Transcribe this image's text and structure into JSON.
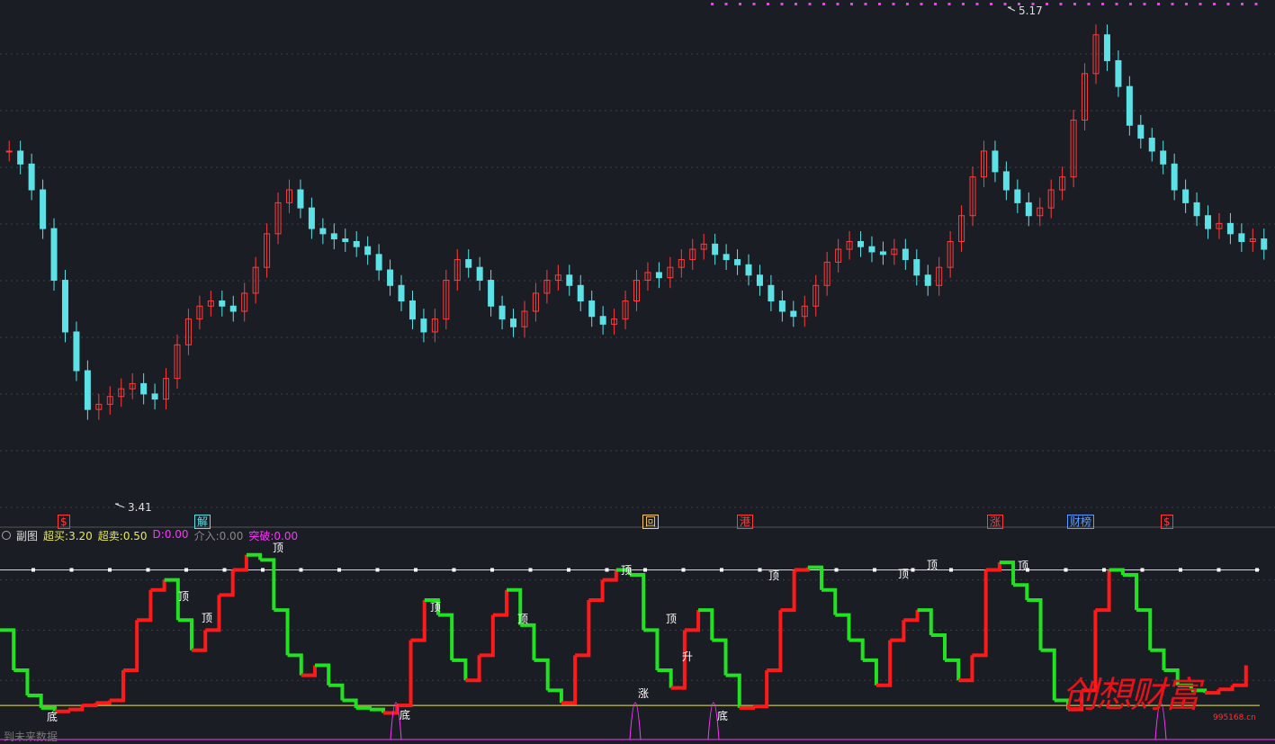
{
  "colors": {
    "background": "#1b1d24",
    "up": "#ff3b3b",
    "down": "#5ce1e6",
    "osc_up": "#ff1a1a",
    "osc_down": "#22e022",
    "threshold": "#e8e85a",
    "magenta": "#ff33ff",
    "grid": "#3a3f4a"
  },
  "main_chart": {
    "high_label": "5.17",
    "low_label": "3.41",
    "event_markers": [
      {
        "id": "marker-s1",
        "text": "$",
        "color": "#ff3b3b",
        "x_index": 0
      },
      {
        "id": "marker-jie",
        "text": "解",
        "color": "#5ce1e6",
        "x_index": 1
      },
      {
        "id": "marker-hui",
        "text": "回",
        "color": "#ffcc55",
        "x_index": 2
      },
      {
        "id": "marker-gang",
        "text": "港",
        "color": "#ff3b3b",
        "x_index": 3
      },
      {
        "id": "marker-zhang",
        "text": "涨",
        "color": "#ff3b3b",
        "x_index": 4
      },
      {
        "id": "marker-caibang",
        "text": "财榜",
        "color": "#5c9bff",
        "x_index": 5
      },
      {
        "id": "marker-s2",
        "text": "$",
        "color": "#ff3b3b",
        "x_index": 6
      }
    ]
  },
  "sub_chart": {
    "title": "副图",
    "legend": [
      {
        "label": "超买:",
        "value": "3.20",
        "color": "#e8e85a"
      },
      {
        "label": "超卖:",
        "value": "0.50",
        "color": "#e8e85a"
      },
      {
        "label": "D:",
        "value": "0.00",
        "color": "#ff33ff"
      },
      {
        "label": "介入:",
        "value": "0.00",
        "color": "#888888"
      },
      {
        "label": "突破:",
        "value": "0.00",
        "color": "#ff33ff"
      }
    ],
    "footer_text": "到未来数据",
    "signal_labels": [
      {
        "text": "底",
        "x": 52,
        "y": 801
      },
      {
        "text": "顶",
        "x": 198,
        "y": 667
      },
      {
        "text": "顶",
        "x": 224,
        "y": 691
      },
      {
        "text": "顶",
        "x": 303,
        "y": 613
      },
      {
        "text": "底",
        "x": 444,
        "y": 799
      },
      {
        "text": "顶",
        "x": 478,
        "y": 679
      },
      {
        "text": "顶",
        "x": 575,
        "y": 692
      },
      {
        "text": "顶",
        "x": 690,
        "y": 638
      },
      {
        "text": "涨",
        "x": 709,
        "y": 775
      },
      {
        "text": "顶",
        "x": 740,
        "y": 692
      },
      {
        "text": "升",
        "x": 758,
        "y": 734
      },
      {
        "text": "底",
        "x": 797,
        "y": 800
      },
      {
        "text": "顶",
        "x": 854,
        "y": 644
      },
      {
        "text": "顶",
        "x": 998,
        "y": 642
      },
      {
        "text": "顶",
        "x": 1030,
        "y": 632
      },
      {
        "text": "顶",
        "x": 1131,
        "y": 633
      }
    ]
  },
  "watermark": {
    "text": "创想财富",
    "url": "995168.cn"
  },
  "chart_data": {
    "type": "candlestick",
    "title": "",
    "price_high": 5.17,
    "price_low": 3.41,
    "ylim": [
      3.3,
      5.25
    ],
    "price_series": [
      4.7,
      4.65,
      4.55,
      4.4,
      4.2,
      4.0,
      3.85,
      3.7,
      3.72,
      3.75,
      3.78,
      3.8,
      3.76,
      3.74,
      3.82,
      3.95,
      4.05,
      4.1,
      4.12,
      4.1,
      4.08,
      4.15,
      4.25,
      4.38,
      4.5,
      4.55,
      4.48,
      4.4,
      4.38,
      4.36,
      4.35,
      4.33,
      4.3,
      4.24,
      4.18,
      4.12,
      4.05,
      4.0,
      4.05,
      4.2,
      4.28,
      4.25,
      4.2,
      4.1,
      4.05,
      4.02,
      4.08,
      4.15,
      4.2,
      4.22,
      4.18,
      4.12,
      4.06,
      4.03,
      4.05,
      4.12,
      4.2,
      4.23,
      4.21,
      4.25,
      4.28,
      4.32,
      4.34,
      4.3,
      4.28,
      4.26,
      4.22,
      4.18,
      4.12,
      4.08,
      4.06,
      4.1,
      4.18,
      4.27,
      4.32,
      4.35,
      4.33,
      4.31,
      4.3,
      4.32,
      4.28,
      4.22,
      4.18,
      4.25,
      4.35,
      4.45,
      4.6,
      4.7,
      4.62,
      4.55,
      4.5,
      4.45,
      4.48,
      4.55,
      4.6,
      4.82,
      5.0,
      5.15,
      5.05,
      4.95,
      4.8,
      4.75,
      4.7,
      4.65,
      4.55,
      4.5,
      4.45,
      4.4,
      4.42,
      4.38,
      4.35,
      4.36,
      4.32
    ],
    "oscillator": {
      "overbought": 3.2,
      "oversold": 0.5,
      "D": 0.0,
      "entry": 0.0,
      "breakout": 0.0,
      "values": [
        2.0,
        1.2,
        0.7,
        0.45,
        0.38,
        0.42,
        0.5,
        0.55,
        0.6,
        1.2,
        2.2,
        2.8,
        3.0,
        2.2,
        1.6,
        2.0,
        2.7,
        3.2,
        3.5,
        3.4,
        2.4,
        1.5,
        1.1,
        1.3,
        0.9,
        0.6,
        0.45,
        0.42,
        0.35,
        0.5,
        1.8,
        2.6,
        2.3,
        1.4,
        1.0,
        1.5,
        2.3,
        2.8,
        2.1,
        1.4,
        0.8,
        0.55,
        1.5,
        2.6,
        3.0,
        3.2,
        3.1,
        2.0,
        1.2,
        0.85,
        2.0,
        2.4,
        1.8,
        1.1,
        0.45,
        0.48,
        1.2,
        2.4,
        3.2,
        3.25,
        2.8,
        2.3,
        1.8,
        1.4,
        0.9,
        1.8,
        2.2,
        2.4,
        1.9,
        1.4,
        1.0,
        1.5,
        3.2,
        3.35,
        2.9,
        2.6,
        1.6,
        0.6,
        0.42,
        0.8,
        2.4,
        3.2,
        3.1,
        2.4,
        1.6,
        1.2,
        0.9,
        0.8,
        0.75,
        0.82,
        0.9,
        1.3
      ]
    }
  }
}
